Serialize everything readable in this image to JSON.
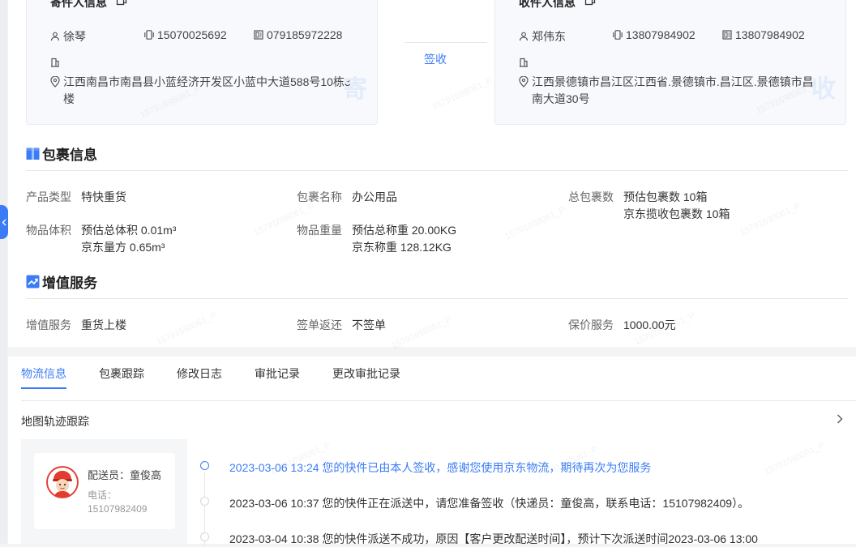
{
  "sender": {
    "title": "寄件人信息",
    "name": "徐琴",
    "mobile": "15070025692",
    "landline": "079185972228",
    "address": "江西南昌市南昌县小蓝经济开发区小蓝中大道588号10栋3楼",
    "watermark": "寄"
  },
  "receiver": {
    "title": "收件人信息",
    "name": "郑伟东",
    "mobile": "13807984902",
    "landline": "13807984902",
    "address": "江西景德镇市昌江区江西省.景德镇市.昌江区.景德镇市昌南大道30号",
    "watermark": "收"
  },
  "sign_status": "签收",
  "package_section": {
    "title": "包裹信息",
    "product_type_label": "产品类型",
    "product_type": "特快重货",
    "package_name_label": "包裹名称",
    "package_name": "办公用品",
    "total_packages_label": "总包裹数",
    "total_packages_est": "预估包裹数 10箱",
    "total_packages_jd": "京东揽收包裹数 10箱",
    "volume_label": "物品体积",
    "volume_est": "预估总体积 0.01m³",
    "volume_jd": "京东量方 0.65m³",
    "weight_label": "物品重量",
    "weight_est": "预估总称重 20.00KG",
    "weight_jd": "京东称重 128.12KG"
  },
  "value_added": {
    "title": "增值服务",
    "service_label": "增值服务",
    "service": "重货上楼",
    "return_label": "签单返还",
    "return": "不签单",
    "insurance_label": "保价服务",
    "insurance": "1000.00元"
  },
  "tabs": [
    "物流信息",
    "包裹跟踪",
    "修改日志",
    "审批记录",
    "更改审批记录"
  ],
  "active_tab": 0,
  "map_track_label": "地图轨迹跟踪",
  "courier": {
    "name_label": "配送员：童俊高",
    "phone_label": "电话：",
    "phone": "15107982409"
  },
  "timeline": [
    {
      "text": "2023-03-06 13:24 您的快件已由本人签收，感谢您使用京东物流，期待再次为您服务",
      "active": true
    },
    {
      "text": "2023-03-06 10:37 您的快件正在派送中，请您准备签收（快递员：童俊高，联系电话：15107982409）。",
      "active": false
    },
    {
      "text": "2023-03-04 10:38 您的快件派送不成功，原因【客户更改配送时间】，预计下次派送时间2023-03-06 13:00",
      "active": false
    }
  ],
  "colors": {
    "accent": "#3b7cf6",
    "panel": "#ffffff",
    "card": "#f7f9fc"
  }
}
